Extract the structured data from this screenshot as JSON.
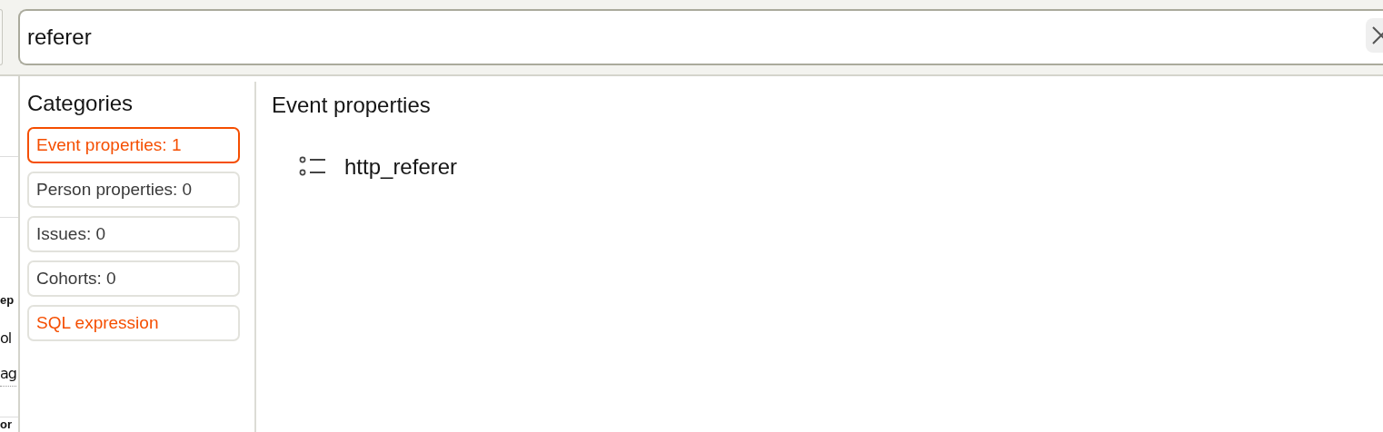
{
  "search": {
    "value": "referer"
  },
  "background_fragments": [
    {
      "text": "ep",
      "kind": "heading"
    },
    {
      "text": "ol",
      "kind": "text"
    },
    {
      "text": "ag",
      "kind": "link"
    },
    {
      "text": "or",
      "kind": "heading"
    }
  ],
  "categories": {
    "title": "Categories",
    "items": [
      {
        "label": "Event properties: 1",
        "selected": true,
        "kind": "category"
      },
      {
        "label": "Person properties: 0",
        "selected": false,
        "kind": "category"
      },
      {
        "label": "Issues: 0",
        "selected": false,
        "kind": "category"
      },
      {
        "label": "Cohorts: 0",
        "selected": false,
        "kind": "category"
      },
      {
        "label": "SQL expression",
        "selected": false,
        "kind": "action"
      }
    ]
  },
  "results": {
    "title": "Event properties",
    "items": [
      {
        "label": "http_referer"
      }
    ]
  }
}
